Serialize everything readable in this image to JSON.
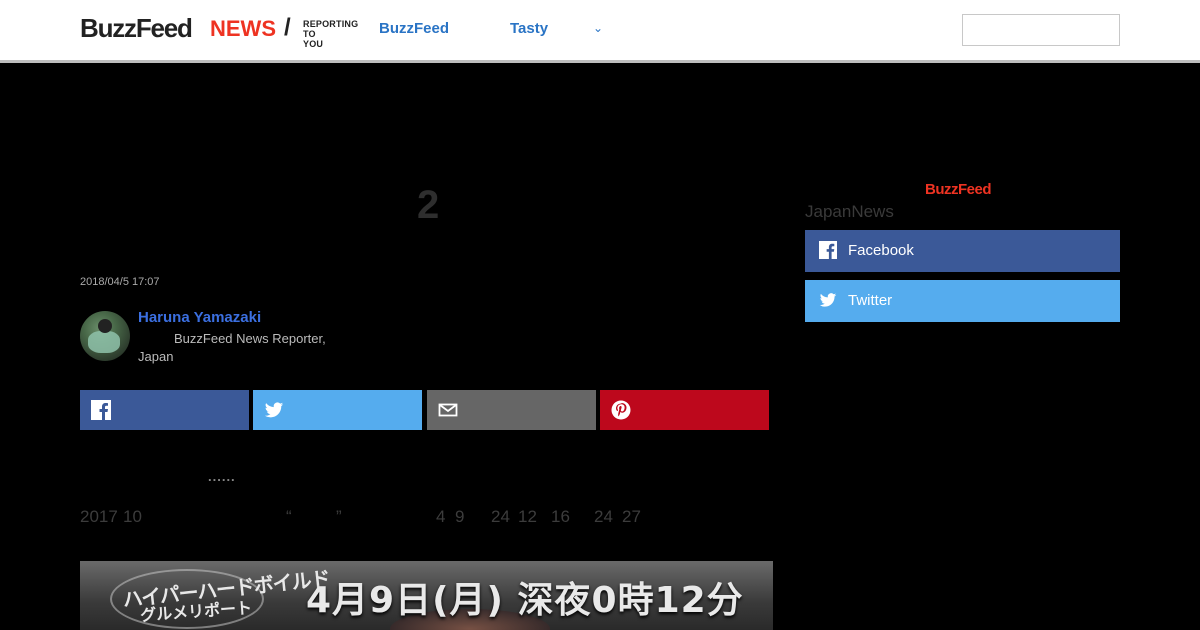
{
  "header": {
    "logo_brand": "BuzzFeed",
    "logo_news": "NEWS",
    "logo_slash": "/",
    "logo_tagline_1": "REPORTING",
    "logo_tagline_2": "TO YOU",
    "nav": [
      {
        "label": "BuzzFeed"
      },
      {
        "label": "Tasty"
      }
    ],
    "more_icon": "chevron-down-icon",
    "search_placeholder": ""
  },
  "article": {
    "headline_visible": "2",
    "date": "2018/04/5 17:07",
    "author": {
      "name": "Haruna Yamazaki",
      "role": "BuzzFeed News Reporter,",
      "location": "Japan"
    },
    "share_buttons": [
      {
        "network": "facebook",
        "icon": "facebook-icon",
        "color": "#3b5998"
      },
      {
        "network": "twitter",
        "icon": "twitter-icon",
        "color": "#55acee"
      },
      {
        "network": "email",
        "icon": "mail-icon",
        "color": "#666666"
      },
      {
        "network": "pinterest",
        "icon": "pinterest-icon",
        "color": "#bd081c"
      }
    ],
    "lead_dots": "......",
    "body_fragments": [
      "2017",
      "10",
      "“",
      "”",
      "4",
      "9",
      "24",
      "12",
      "16",
      "24",
      "27"
    ],
    "banner": {
      "left_text_1": "ハイパーハードボイルド",
      "left_text_2": "グルメリポート",
      "right_text": "4月9日(月) 深夜0時12分"
    }
  },
  "sidebar": {
    "brand": "BuzzFeed",
    "label": "JapanNews",
    "follow": [
      {
        "label": "Facebook",
        "icon": "facebook-icon",
        "color": "#3b5998"
      },
      {
        "label": "Twitter",
        "icon": "twitter-icon",
        "color": "#55acee"
      }
    ]
  }
}
